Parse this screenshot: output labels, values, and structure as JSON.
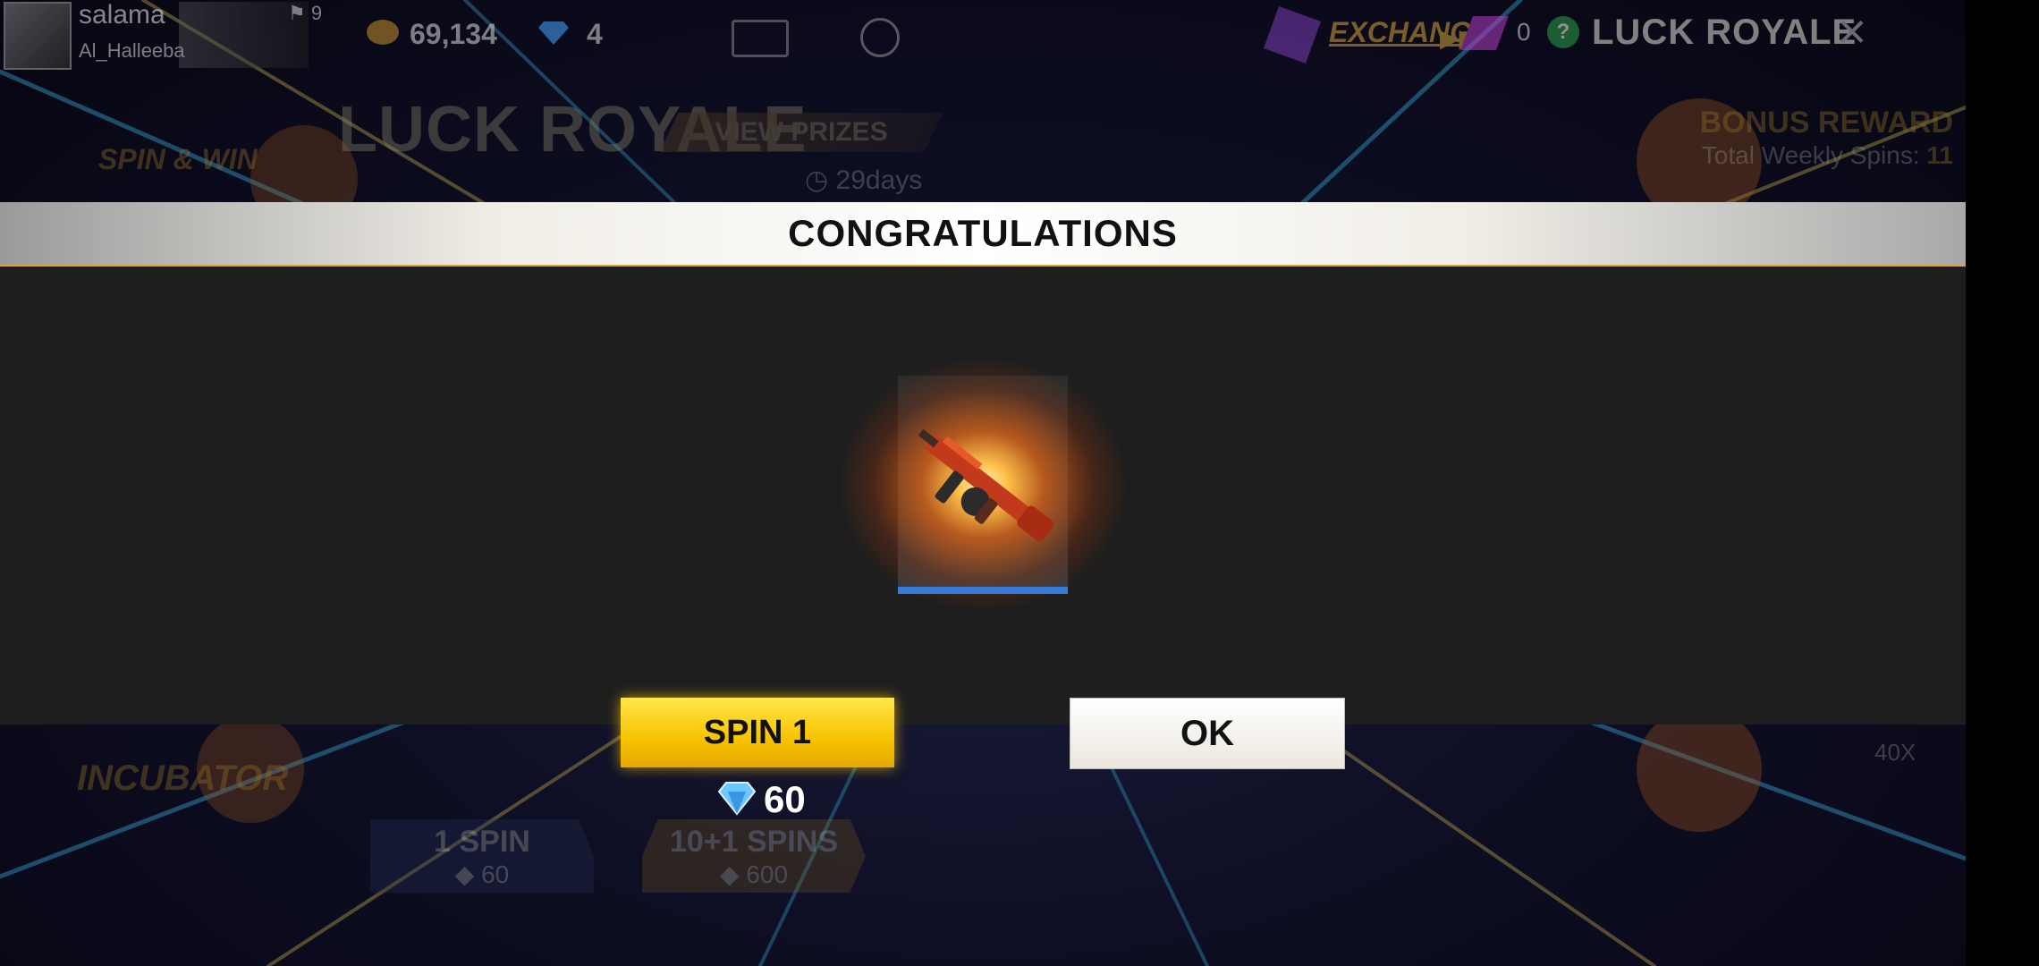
{
  "hud": {
    "player_name": "salama",
    "guild_name": "Al_Halleeba",
    "level": "9",
    "gold": "69,134",
    "diamonds": "4",
    "exchange_label": "EXCHANGE",
    "tickets": "0",
    "help_icon": "?",
    "title": "LUCK ROYALE",
    "close_icon": "×"
  },
  "background": {
    "title": "LUCK ROYALE",
    "view_prizes": "VIEW PRIZES",
    "remaining": "29days",
    "mode": "SPIN & WIN",
    "bonus_reward": "BONUS REWARD",
    "weekly_spins_label": "Total Weekly Spins:",
    "weekly_spins_value": "11",
    "incubator": "INCUBATOR",
    "one_spin_label": "1 SPIN",
    "one_spin_cost": "60",
    "ten_spin_label": "10+1 SPINS",
    "ten_spin_cost": "600",
    "multiplier": "40X"
  },
  "modal": {
    "title": "CONGRATULATIONS",
    "prize_icon": "thompson-gun-icon",
    "spin_button": "SPIN 1",
    "ok_button": "OK",
    "spin_cost": "60"
  },
  "colors": {
    "accent_yellow": "#f7c300",
    "gold_text": "#e6b13c",
    "modal_body": "#1e1e1e",
    "rarity_bar": "#3a7bd8"
  }
}
